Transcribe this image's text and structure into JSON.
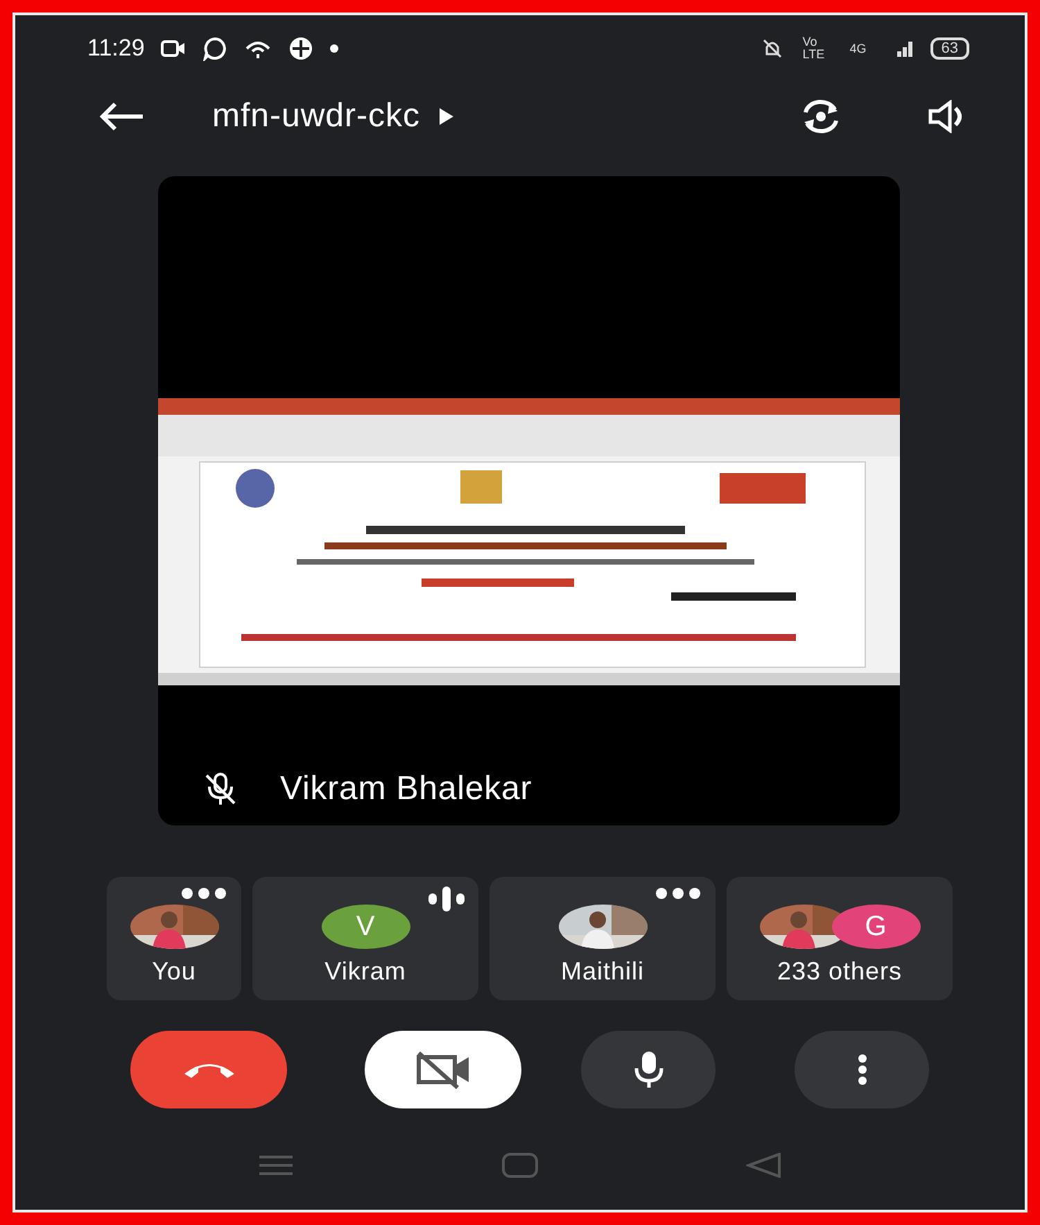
{
  "status_bar": {
    "time": "11:29",
    "network_labels": [
      "Vo LTE",
      "4G"
    ],
    "battery": "63"
  },
  "header": {
    "meeting_code": "mfn-uwdr-ckc"
  },
  "main_tile": {
    "name": "Vikram Bhalekar",
    "muted": true,
    "content": {
      "kind": "picture"
    }
  },
  "participants": [
    {
      "name": "You",
      "menu": true,
      "speaking": false,
      "avatars": [
        {
          "kind": "picture"
        }
      ]
    },
    {
      "name": "Vikram",
      "menu": false,
      "speaking": true,
      "avatars": [
        {
          "kind": "letter",
          "letter": "V",
          "color": "#6aa13c"
        }
      ]
    },
    {
      "name": "Maithili",
      "menu": true,
      "speaking": false,
      "avatars": [
        {
          "kind": "picture"
        }
      ]
    },
    {
      "name": "233 others",
      "menu": false,
      "speaking": false,
      "avatars": [
        {
          "kind": "picture"
        },
        {
          "kind": "letter",
          "letter": "G",
          "color": "#e2447a"
        }
      ]
    }
  ],
  "controls": [
    {
      "kind": "end_call"
    },
    {
      "kind": "camera",
      "on": false
    },
    {
      "kind": "microphone",
      "on": true
    },
    {
      "kind": "more"
    }
  ]
}
